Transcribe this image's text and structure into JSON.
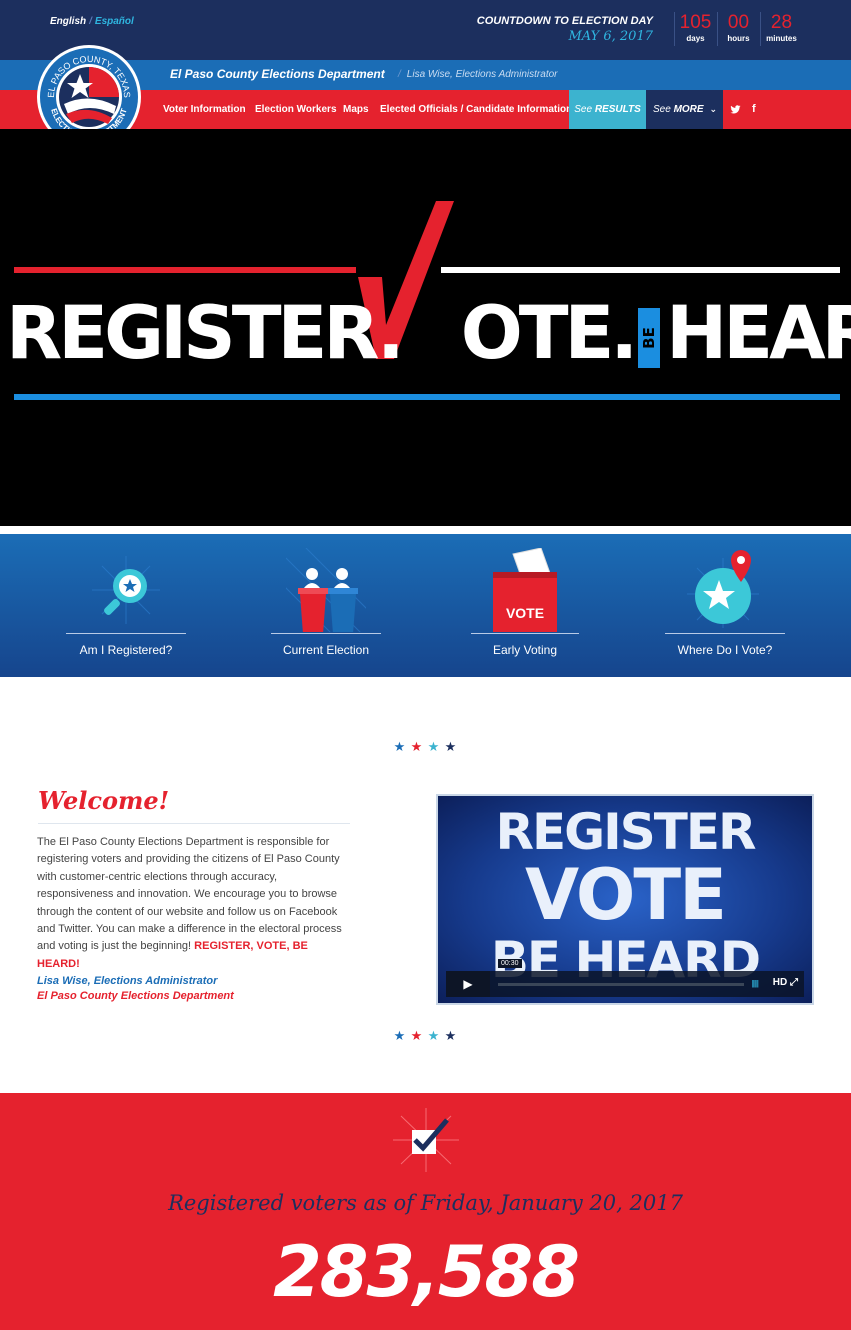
{
  "header": {
    "lang_english": "English",
    "lang_separator": "/",
    "lang_spanish": "Español",
    "countdown_label": "COUNTDOWN TO ELECTION DAY",
    "countdown_date": "MAY 6, 2017",
    "countdown": [
      {
        "value": "105",
        "unit": "days"
      },
      {
        "value": "00",
        "unit": "hours"
      },
      {
        "value": "28",
        "unit": "minutes"
      }
    ]
  },
  "bluebar": {
    "department": "El Paso County Elections Department",
    "separator": "/",
    "administrator": "Lisa Wise, Elections Administrator"
  },
  "logo": {
    "top_text": "EL PASO COUNTY, TEXAS",
    "bottom_text": "ELECTIONS DEPARTMENT"
  },
  "nav": {
    "items": [
      {
        "label": "Voter Information"
      },
      {
        "label": "Election Workers"
      },
      {
        "label": "Maps"
      },
      {
        "label": "Elected Officials / Candidate Information"
      }
    ],
    "results_prefix": "See",
    "results_label": "RESULTS",
    "more_prefix": "See",
    "more_label": "MORE",
    "social": [
      {
        "icon": "twitter-icon",
        "glyph": "🐦"
      },
      {
        "icon": "facebook-icon",
        "glyph": "f"
      }
    ]
  },
  "hero": {
    "register": "REGISTER.",
    "vote_rest": "OTE.",
    "be": "BE",
    "heard": "HEARD.",
    "colors": {
      "red": "#e5222e",
      "white": "#ffffff",
      "blue": "#1b8ee0"
    }
  },
  "quick_links": [
    {
      "label": "Am I Registered?",
      "icon": "magnifier-star-icon"
    },
    {
      "label": "Current Election",
      "icon": "podiums-icon"
    },
    {
      "label": "Early Voting",
      "icon": "ballot-box-icon",
      "badge": "VOTE"
    },
    {
      "label": "Where Do I Vote?",
      "icon": "map-pin-star-icon"
    }
  ],
  "stars": [
    {
      "glyph": "★",
      "color": "#1b6db6"
    },
    {
      "glyph": "★",
      "color": "#e5222e"
    },
    {
      "glyph": "★",
      "color": "#3cb3cf"
    },
    {
      "glyph": "★",
      "color": "#1c2f5e"
    }
  ],
  "welcome": {
    "title": "Welcome!",
    "body": "The El Paso County Elections Department is responsible for registering voters and providing the citizens of El Paso County with customer-centric elections through accuracy, responsiveness and innovation. We encourage you to browse through the content of our website and follow us on Facebook and Twitter. You can make a difference in the electoral process and voting is just the beginning!",
    "emphasis": "REGISTER, VOTE, BE HEARD!",
    "signature_name": "Lisa Wise, Elections Administrator",
    "signature_dept": "El Paso County Elections Department"
  },
  "video": {
    "line1": "REGISTER",
    "line2": "VOTE",
    "line3": "BE HEARD",
    "time": "00:30",
    "hd_label": "HD",
    "volume": "||||||"
  },
  "stats": {
    "label": "Registered voters as of Friday, January 20, 2017",
    "value": "283,588"
  }
}
